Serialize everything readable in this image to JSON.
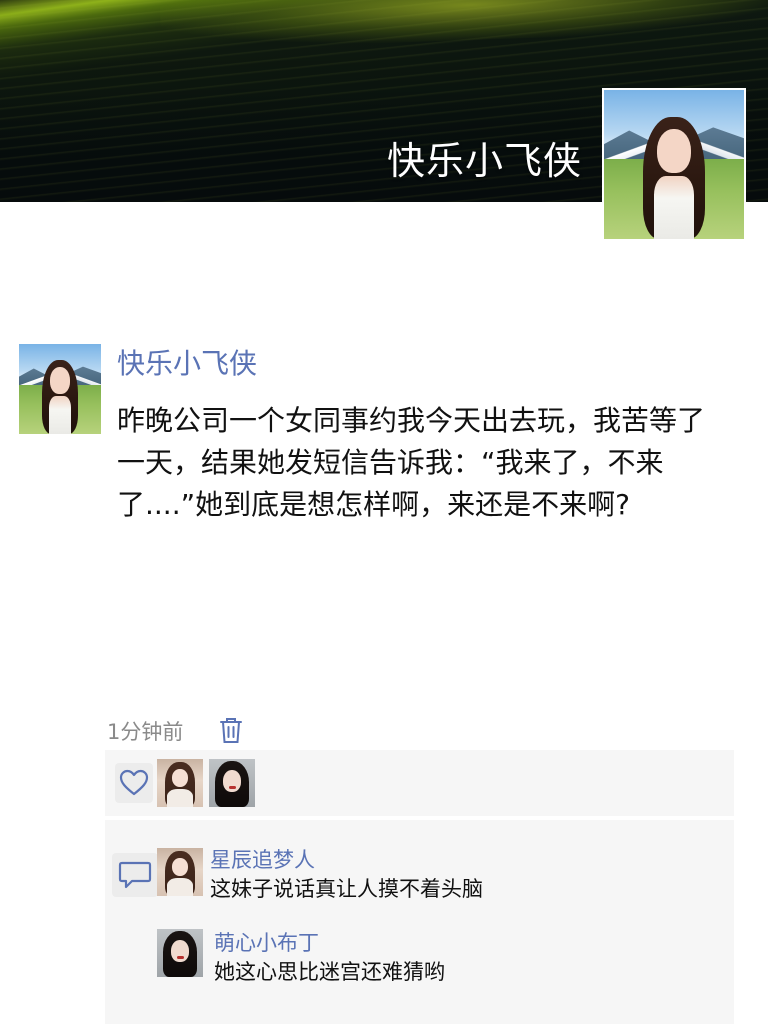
{
  "profile": {
    "display_name": "快乐小飞侠"
  },
  "post": {
    "author": "快乐小飞侠",
    "text": "昨晚公司一个女同事约我今天出去玩，我苦等了一天，结果她发短信告诉我：“我来了，不来了....”她到底是想怎样啊，来还是不来啊?",
    "time": "1分钟前"
  },
  "likes": {
    "icon": "heart-outline-icon",
    "avatars": [
      "doll-avatar",
      "portrait-avatar"
    ]
  },
  "comments": [
    {
      "author": "星辰追梦人",
      "text": "这妹子说话真让人摸不着头脑",
      "avatar": "doll-avatar"
    },
    {
      "author": "萌心小布丁",
      "text": "她这心思比迷宫还难猜哟",
      "avatar": "portrait-avatar"
    }
  ],
  "icons": {
    "delete": "trash-icon",
    "comment": "speech-bubble-icon"
  },
  "colors": {
    "link_blue": "#5a73b5",
    "panel_bg": "#f6f6f6",
    "time_gray": "#8a8a8a"
  }
}
